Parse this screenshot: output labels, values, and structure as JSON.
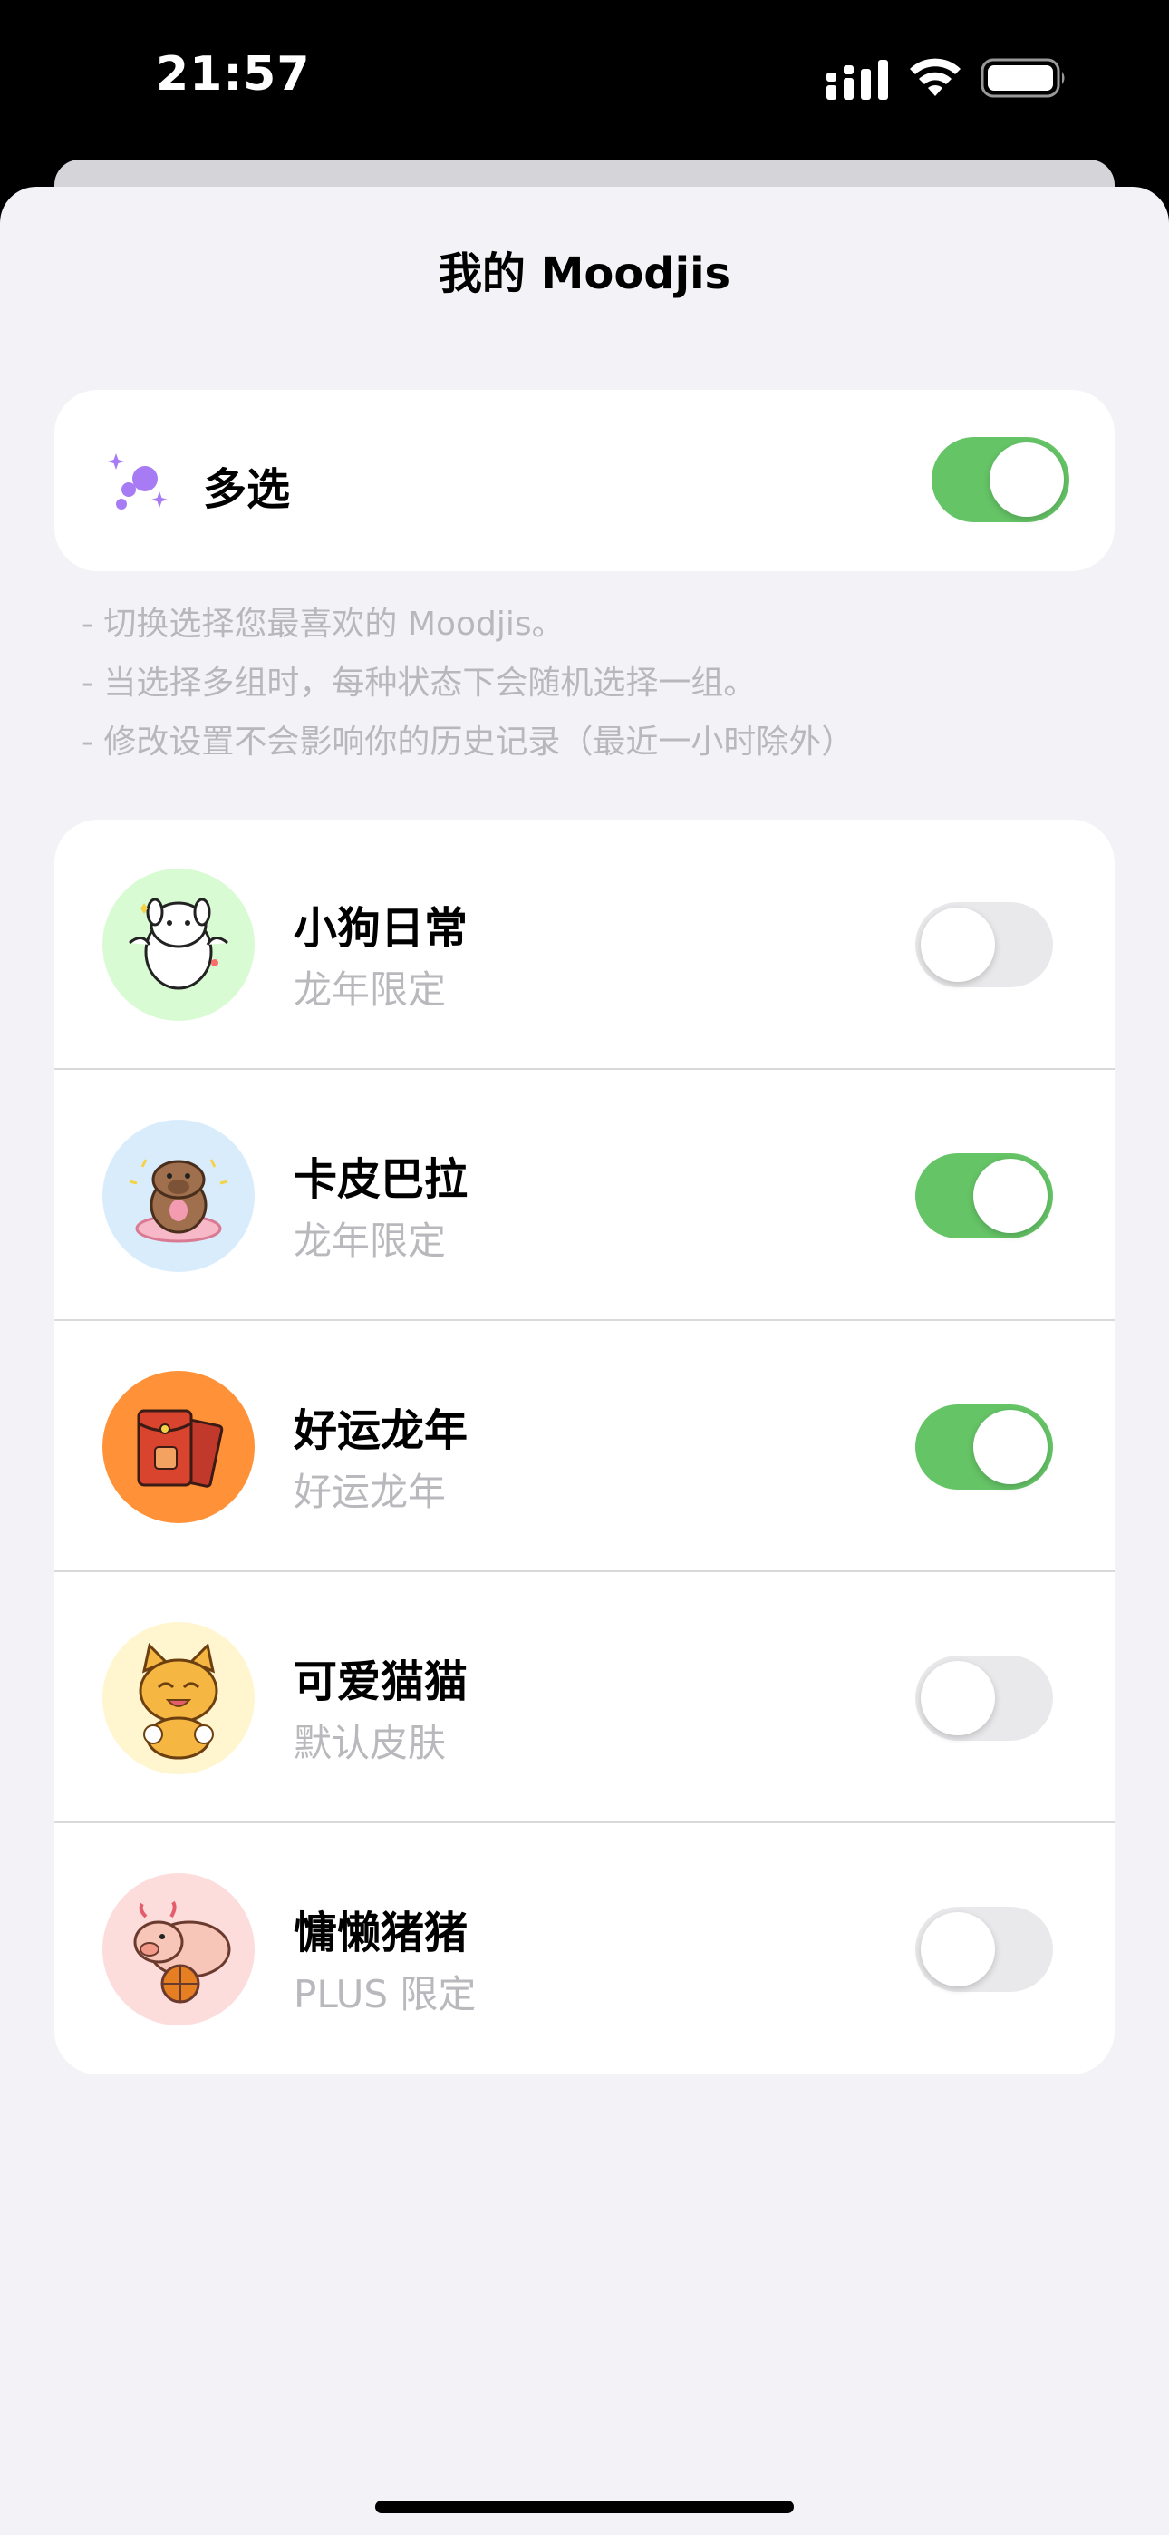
{
  "status_bar": {
    "time": "21:57",
    "icons": [
      "cellular-signal-icon",
      "wifi-icon",
      "battery-icon"
    ]
  },
  "sheet": {
    "title": "我的 Moodjis"
  },
  "multi_select": {
    "icon": "sparkles-icon",
    "label": "多选",
    "enabled": true
  },
  "notes": [
    "- 切换选择您最喜欢的 Moodjis。",
    "- 当选择多组时，每种状态下会随机选择一组。",
    "- 修改设置不会影响你的历史记录（最近一小时除外）"
  ],
  "packs": [
    {
      "name": "小狗日常",
      "subtitle": "龙年限定",
      "enabled": false,
      "avatar": "puppy-avatar-icon",
      "avatar_bg": "#d9fbd3"
    },
    {
      "name": "卡皮巴拉",
      "subtitle": "龙年限定",
      "enabled": true,
      "avatar": "capybara-avatar-icon",
      "avatar_bg": "#d9ecfb"
    },
    {
      "name": "好运龙年",
      "subtitle": "好运龙年",
      "enabled": true,
      "avatar": "red-envelope-avatar-icon",
      "avatar_bg": "#ff9238"
    },
    {
      "name": "可爱猫猫",
      "subtitle": "默认皮肤",
      "enabled": false,
      "avatar": "cat-avatar-icon",
      "avatar_bg": "#fff5cf"
    },
    {
      "name": "慵懒猪猪",
      "subtitle": "PLUS 限定",
      "enabled": false,
      "avatar": "pig-avatar-icon",
      "avatar_bg": "#fddcdc"
    }
  ],
  "colors": {
    "toggle_on": "#65c466",
    "toggle_off": "#e9e9eb",
    "sheet_bg": "#f2f2f7",
    "subtitle": "#b9b9bd",
    "accent_purple": "#a77bf3"
  }
}
